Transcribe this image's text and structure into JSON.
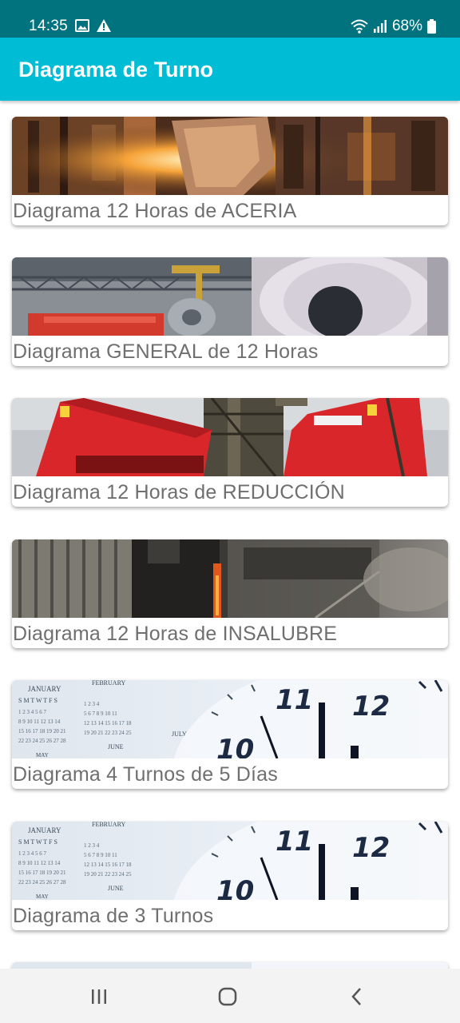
{
  "status_bar": {
    "time": "14:35",
    "battery": "68%",
    "icons_left": [
      "image-icon",
      "alert-icon"
    ],
    "icons_right": [
      "wifi-icon",
      "signal-icon",
      "battery-icon"
    ]
  },
  "app_bar": {
    "title": "Diagrama de Turno"
  },
  "items": [
    {
      "label": "Diagrama 12 Horas de ACERIA",
      "image": "steel-pour-photo"
    },
    {
      "label": "Diagrama GENERAL de 12 Horas",
      "image": "steel-coil-photo"
    },
    {
      "label": "Diagrama 12 Horas de REDUCCIÓN",
      "image": "industrial-plant-photo"
    },
    {
      "label": "Diagrama 12 Horas de INSALUBRE",
      "image": "furnace-smoke-photo"
    },
    {
      "label": "Diagrama 4 Turnos de 5 Días",
      "image": "calendar-clock-photo"
    },
    {
      "label": "Diagrama de 3 Turnos",
      "image": "calendar-clock-photo"
    }
  ],
  "calendar_image_text": {
    "months": [
      "JANUARY",
      "FEBRUARY",
      "JUNE",
      "JULY",
      "MAY"
    ],
    "weekdays": "S M T W T F S",
    "clock_numbers": [
      "11",
      "12",
      "10"
    ]
  },
  "nav_bar": {
    "icons": [
      "recent-apps-icon",
      "home-icon",
      "back-icon"
    ]
  },
  "colors": {
    "status_bar": "#00737f",
    "app_bar": "#00bcd4",
    "label_text": "#6f6f6f",
    "nav_bar": "#f3f3f3"
  }
}
